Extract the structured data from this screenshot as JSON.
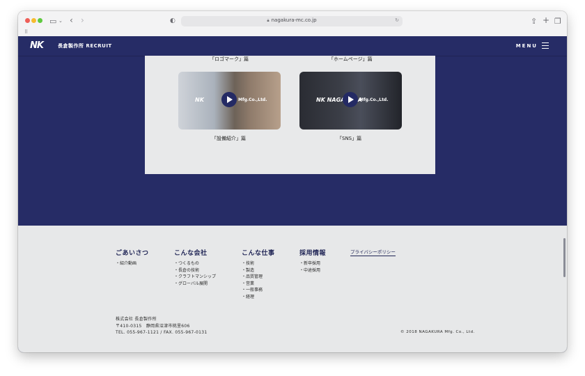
{
  "browser": {
    "url": "nagakura-mc.co.jp"
  },
  "header": {
    "logo_mark": "NK",
    "logo_text": "長倉製作所 RECRUIT",
    "menu_label": "MENU"
  },
  "videos": {
    "top_captions": [
      "「ロゴマーク」篇",
      "「ホームページ」篇"
    ],
    "items": [
      {
        "caption": "「設備紹介」篇",
        "brand": "NK",
        "brand_suffix": "Mfg.Co.,Ltd."
      },
      {
        "caption": "「SNS」篇",
        "brand": "NK NAGAKURA",
        "brand_suffix": "Mfg.Co.,Ltd."
      }
    ]
  },
  "footer": {
    "columns": [
      {
        "heading": "ごあいさつ",
        "items": [
          "・紹介動画"
        ]
      },
      {
        "heading": "こんな会社",
        "items": [
          "・つくるもの",
          "・長倉の技術",
          "・クラフトマンシップ",
          "・グローバル展開"
        ]
      },
      {
        "heading": "こんな仕事",
        "items": [
          "・技術",
          "・製造",
          "・品質管理",
          "・営業",
          "・一般事務",
          "・経理"
        ]
      },
      {
        "heading": "採用情報",
        "items": [
          "・新卒採用",
          "・中途採用"
        ]
      }
    ],
    "privacy": "プライバシーポリシー",
    "company_lines": [
      "株式会社 長倉製作所",
      "〒410-0315　静岡県沼津市桃里606",
      "TEL. 055-967-1121 / FAX. 055-967-0131"
    ],
    "copyright": "© 2018 NAGAKURA Mfg. Co., Ltd."
  },
  "colors": {
    "brand_navy": "#262c66",
    "footer_bg": "#e7e8e9"
  }
}
